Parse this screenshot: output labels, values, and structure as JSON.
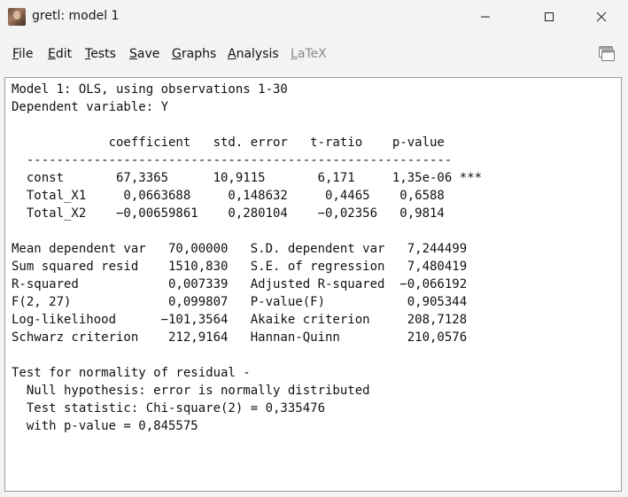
{
  "window": {
    "title": "gretl: model 1",
    "minimize_glyph": "–",
    "close_glyph": "✕"
  },
  "icons": {
    "app": "gretl-app-icon",
    "toolbar": "copy-window-icon",
    "minimize": "minimize-icon",
    "maximize": "maximize-icon",
    "close": "close-icon"
  },
  "menu": {
    "items": [
      {
        "label": "File",
        "underline": "F",
        "rest": "ile",
        "enabled": true
      },
      {
        "label": "Edit",
        "underline": "E",
        "rest": "dit",
        "enabled": true
      },
      {
        "label": "Tests",
        "underline": "T",
        "rest": "ests",
        "enabled": true
      },
      {
        "label": "Save",
        "underline": "S",
        "rest": "ave",
        "enabled": true
      },
      {
        "label": "Graphs",
        "underline": "G",
        "rest": "raphs",
        "enabled": true
      },
      {
        "label": "Analysis",
        "underline": "A",
        "rest": "nalysis",
        "enabled": true
      },
      {
        "label": "LaTeX",
        "underline": "L",
        "rest": "aTeX",
        "enabled": false
      }
    ]
  },
  "output": {
    "lines": [
      "Model 1: OLS, using observations 1-30",
      "Dependent variable: Y",
      "",
      "             coefficient   std. error   t-ratio    p-value",
      "  ---------------------------------------------------------",
      "  const       67,3365      10,9115       6,171     1,35e-06 ***",
      "  Total_X1     0,0663688     0,148632     0,4465    0,6588",
      "  Total_X2    −0,00659861    0,280104    −0,02356   0,9814",
      "",
      "Mean dependent var   70,00000   S.D. dependent var   7,244499",
      "Sum squared resid    1510,830   S.E. of regression   7,480419",
      "R-squared            0,007339   Adjusted R-squared  −0,066192",
      "F(2, 27)             0,099807   P-value(F)           0,905344",
      "Log-likelihood      −101,3564   Akaike criterion     208,7128",
      "Schwarz criterion    212,9164   Hannan-Quinn         210,0576",
      "",
      "Test for normality of residual -",
      "  Null hypothesis: error is normally distributed",
      "  Test statistic: Chi-square(2) = 0,335476",
      "  with p-value = 0,845575"
    ]
  }
}
